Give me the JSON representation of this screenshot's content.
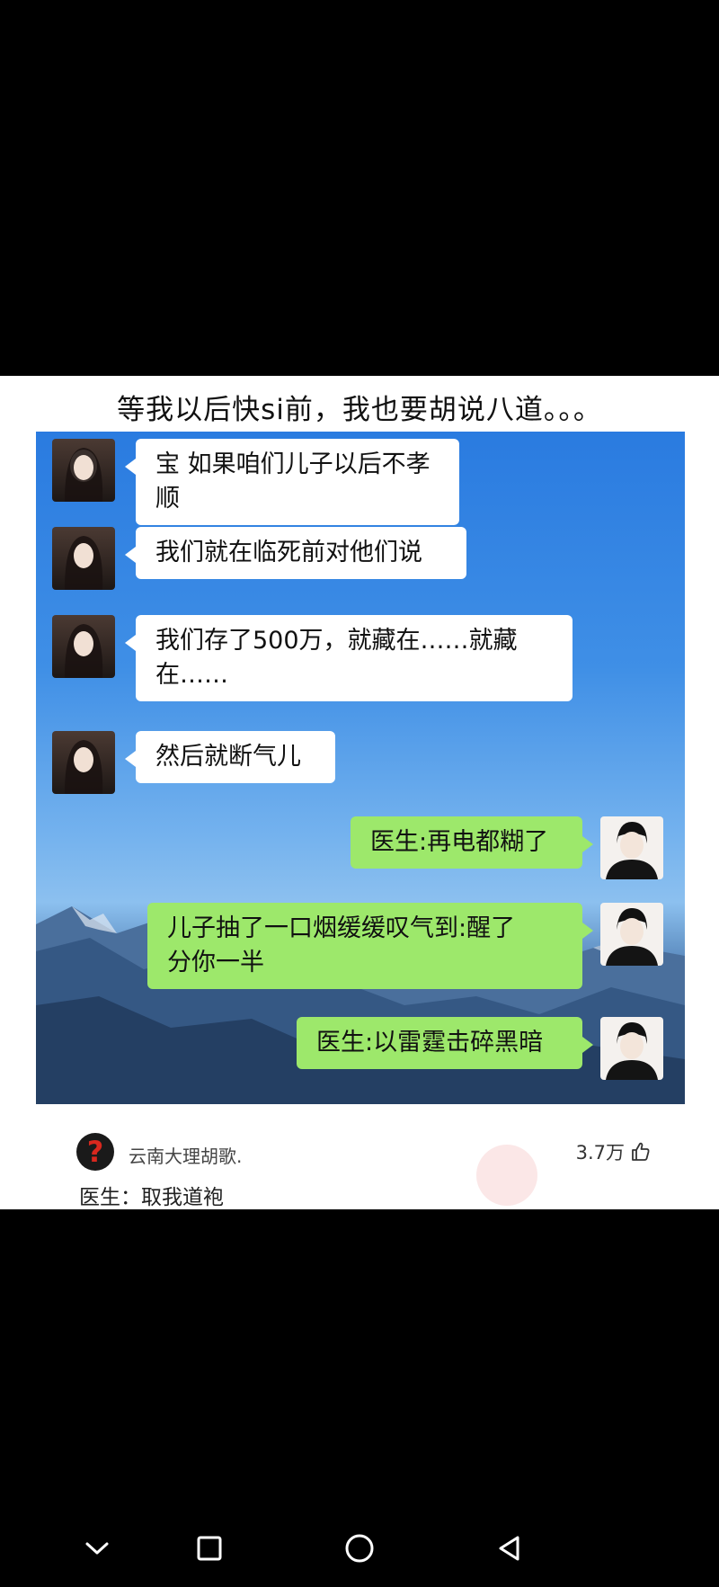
{
  "post": {
    "caption": "等我以后快si前，我也要胡说八道。。。"
  },
  "chat": {
    "messages": [
      {
        "side": "left",
        "text": "宝 如果咱们儿子以后不孝顺"
      },
      {
        "side": "left",
        "text": "我们就在临死前对他们说"
      },
      {
        "side": "left",
        "text_line1": "我们存了500万，就藏在……就藏",
        "text_line2": "在……"
      },
      {
        "side": "left",
        "text": "然后就断气儿"
      },
      {
        "side": "right",
        "text": "医生:再电都糊了"
      },
      {
        "side": "right",
        "text_line1": "儿子抽了一口烟缓缓叹气到:醒了",
        "text_line2": "分你一半"
      },
      {
        "side": "right",
        "text": "医生:以雷霆击碎黑暗"
      }
    ]
  },
  "comment": {
    "username": "云南大理胡歌.",
    "likes": "3.7万",
    "text": "医生：取我道袍"
  },
  "icons": {
    "like": "thumbs-up-icon",
    "nav_back": "triangle-back-icon",
    "nav_home": "circle-home-icon",
    "nav_recents": "square-recents-icon",
    "nav_collapse": "chevron-down-icon"
  }
}
